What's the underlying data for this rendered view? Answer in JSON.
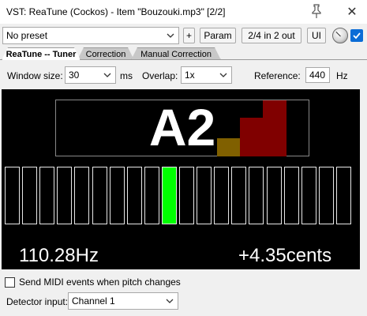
{
  "window": {
    "title": "VST: ReaTune (Cockos) - Item \"Bouzouki.mp3\" [2/2]",
    "close_glyph": "✕"
  },
  "toolbar": {
    "preset_value": "No preset",
    "plus_label": "+",
    "param_label": "Param",
    "io_label": "2/4 in 2 out",
    "ui_label": "UI",
    "bypass_checked": true
  },
  "tabs": [
    {
      "label": "ReaTune -- Tuner",
      "active": true
    },
    {
      "label": "Correction",
      "active": false
    },
    {
      "label": "Manual Correction",
      "active": false
    }
  ],
  "settings": {
    "window_size_label": "Window size:",
    "window_size_value": "30",
    "window_size_unit": "ms",
    "overlap_label": "Overlap:",
    "overlap_value": "1x",
    "reference_label": "Reference:",
    "reference_value": "440",
    "reference_unit": "Hz"
  },
  "tuner": {
    "note": "A2",
    "frequency": "110.28Hz",
    "cents": "+4.35cents",
    "meter_cells": 20,
    "active_cell": 10,
    "colors": {
      "background": "#000000",
      "active_cell": "#00ff00",
      "level_dark": "#806000",
      "level_red": "#800000"
    }
  },
  "midi": {
    "send_label": "Send MIDI events when pitch changes",
    "checked": false
  },
  "detector": {
    "label": "Detector input:",
    "value": "Channel 1"
  },
  "icons": [
    "pin-icon",
    "close-icon",
    "chevron-down-icon",
    "knob-icon",
    "checkmark-icon"
  ]
}
